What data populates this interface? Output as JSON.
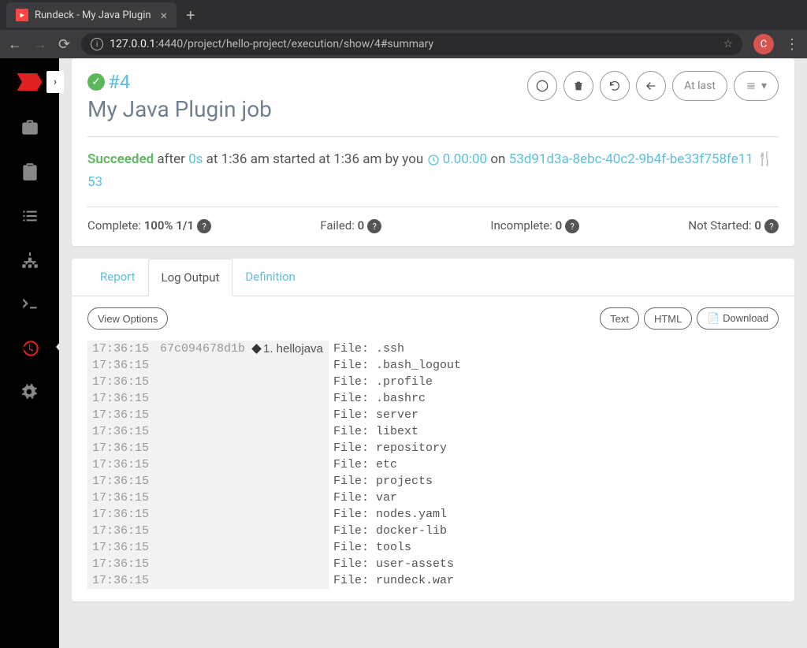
{
  "browser": {
    "tab_title": "Rundeck - My Java Plugin",
    "url_prefix": "127.0.0.1",
    "url_path": ":4440/project/hello-project/execution/show/4#summary",
    "avatar_letter": "C"
  },
  "header": {
    "exec_num": "#4",
    "job_name": "My Java Plugin job",
    "at_last": "At last"
  },
  "status": {
    "succeeded": "Succeeded",
    "after": " after ",
    "duration": "0s",
    "at_time": " at 1:36 am started at 1:36 am by you ",
    "elapsed": "0.00:00",
    "on": " on ",
    "exec_id": "53d91d3a-8ebc-40c2-9b4f-be33f758fe11",
    "count": "53"
  },
  "stats": {
    "complete_label": "Complete: ",
    "complete_value": "100% 1/1",
    "failed_label": "Failed: ",
    "failed_value": "0",
    "incomplete_label": "Incomplete: ",
    "incomplete_value": "0",
    "notstarted_label": "Not Started: ",
    "notstarted_value": "0"
  },
  "tabs": {
    "report": "Report",
    "log_output": "Log Output",
    "definition": "Definition"
  },
  "opts": {
    "view_options": "View Options",
    "text": "Text",
    "html": "HTML",
    "download": "Download"
  },
  "log": {
    "node": "67c094678d1b",
    "step": "1. hellojava",
    "rows": [
      {
        "time": "17:36:15",
        "msg": "File: .ssh"
      },
      {
        "time": "17:36:15",
        "msg": "File: .bash_logout"
      },
      {
        "time": "17:36:15",
        "msg": "File: .profile"
      },
      {
        "time": "17:36:15",
        "msg": "File: .bashrc"
      },
      {
        "time": "17:36:15",
        "msg": "File: server"
      },
      {
        "time": "17:36:15",
        "msg": "File: libext"
      },
      {
        "time": "17:36:15",
        "msg": "File: repository"
      },
      {
        "time": "17:36:15",
        "msg": "File: etc"
      },
      {
        "time": "17:36:15",
        "msg": "File: projects"
      },
      {
        "time": "17:36:15",
        "msg": "File: var"
      },
      {
        "time": "17:36:15",
        "msg": "File: nodes.yaml"
      },
      {
        "time": "17:36:15",
        "msg": "File: docker-lib"
      },
      {
        "time": "17:36:15",
        "msg": "File: tools"
      },
      {
        "time": "17:36:15",
        "msg": "File: user-assets"
      },
      {
        "time": "17:36:15",
        "msg": "File: rundeck.war"
      }
    ]
  }
}
